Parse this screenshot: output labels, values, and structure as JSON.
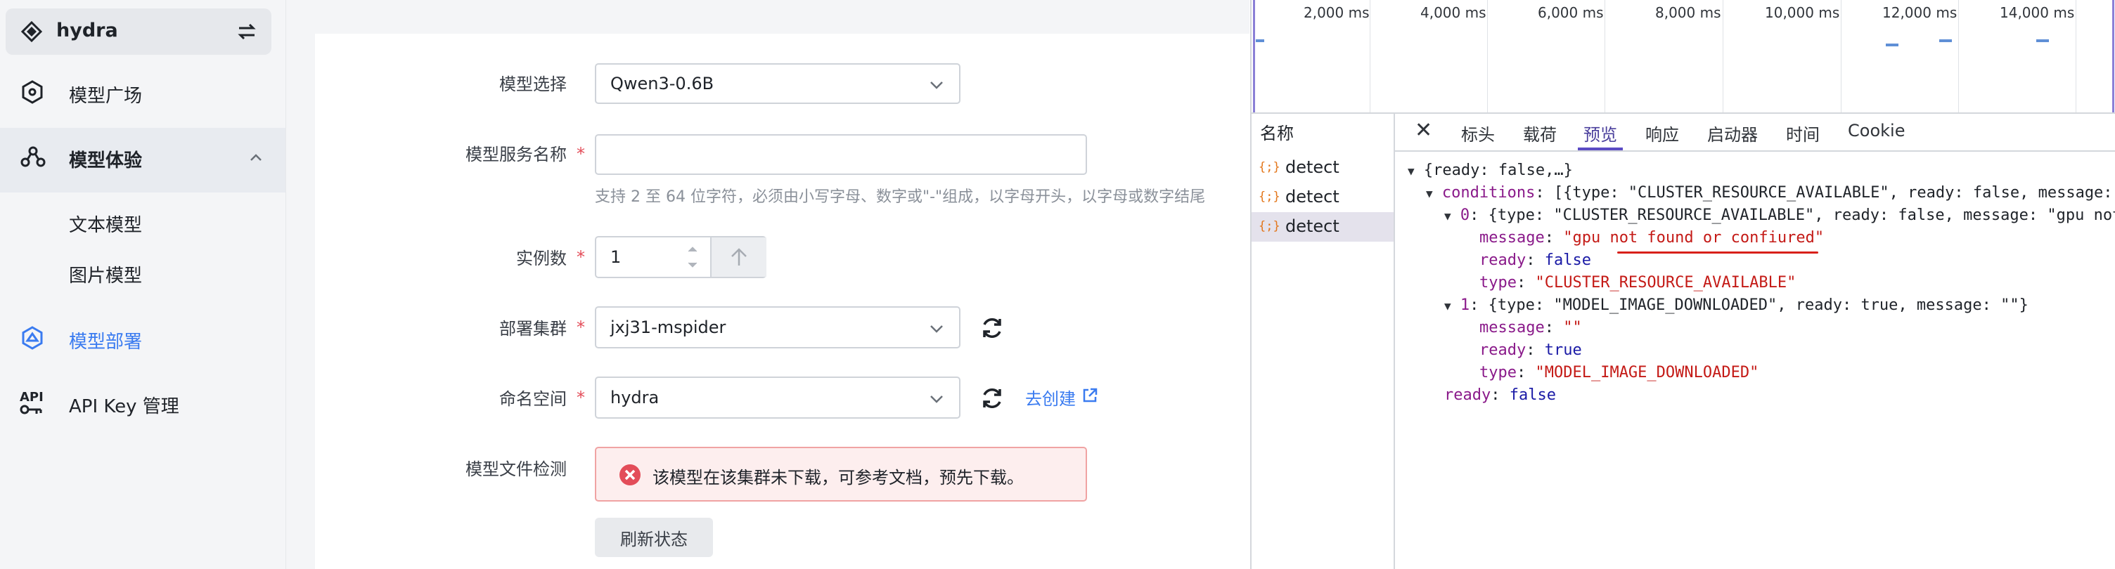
{
  "sidebar": {
    "app_name": "hydra",
    "items": [
      {
        "label": "模型广场"
      },
      {
        "label": "模型体验"
      },
      {
        "label": "文本模型"
      },
      {
        "label": "图片模型"
      },
      {
        "label": "模型部署"
      },
      {
        "label": "API Key 管理"
      }
    ],
    "active_color": "#3a7bf0"
  },
  "form": {
    "model_select": {
      "label": "模型选择",
      "value": "Qwen3-0.6B"
    },
    "service_name": {
      "label": "模型服务名称",
      "value": "",
      "hint": "支持 2 至 64 位字符，必须由小写字母、数字或\"-\"组成，以字母开头，以字母或数字结尾"
    },
    "instances": {
      "label": "实例数",
      "value": "1"
    },
    "cluster": {
      "label": "部署集群",
      "value": "jxj31-mspider"
    },
    "namespace": {
      "label": "命名空间",
      "value": "hydra",
      "create_link": "去创建"
    },
    "file_check": {
      "label": "模型文件检测",
      "alert": "该模型在该集群未下载，可参考文档，预先下载。",
      "refresh_button": "刷新状态"
    },
    "required_mark": "*"
  },
  "devtools": {
    "timeline_ticks": [
      "2,000 ms",
      "4,000 ms",
      "6,000 ms",
      "8,000 ms",
      "10,000 ms",
      "12,000 ms",
      "14,000 ms"
    ],
    "name_header": "名称",
    "requests": [
      {
        "icon": "{;}",
        "name": "detect"
      },
      {
        "icon": "{;}",
        "name": "detect"
      },
      {
        "icon": "{;}",
        "name": "detect"
      }
    ],
    "close_label": "✕",
    "tabs": [
      "标头",
      "载荷",
      "预览",
      "响应",
      "启动器",
      "时间",
      "Cookie"
    ],
    "active_tab": "预览",
    "preview": {
      "root": "{ready: false,…}",
      "conditions_key": "conditions",
      "conditions_summary": "[{type: \"CLUSTER_RESOURCE_AVAILABLE\", ready: false, message: \"gpu not",
      "item0_key": "0",
      "item0_summary": "{type: \"CLUSTER_RESOURCE_AVAILABLE\", ready: false, message: \"gpu not",
      "item0_message": "\"gpu not found or confiured\"",
      "item0_ready": "false",
      "item0_type": "\"CLUSTER_RESOURCE_AVAILABLE\"",
      "item1_key": "1",
      "item1_summary": "{type: \"MODEL_IMAGE_DOWNLOADED\", ready: true, message: \"\"}",
      "item1_message": "\"\"",
      "item1_ready": "true",
      "item1_type": "\"MODEL_IMAGE_DOWNLOADED\"",
      "ready_key": "ready",
      "ready_value": "false",
      "message_key": "message",
      "type_key": "type"
    }
  }
}
